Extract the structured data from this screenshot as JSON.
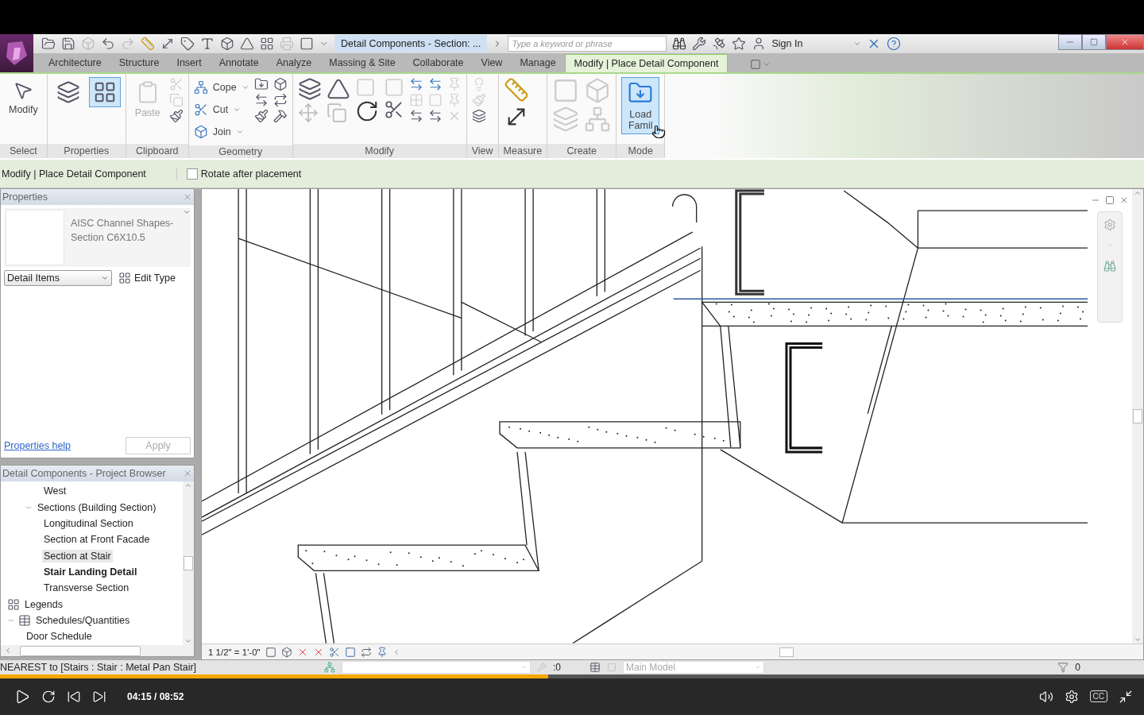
{
  "quick_access": {
    "title": "Detail Components - Section: ...",
    "search": {
      "placeholder": "Type a keyword or phrase"
    },
    "sign_in": "Sign In"
  },
  "ribbon_tabs": [
    {
      "label": "Architecture",
      "selected": false
    },
    {
      "label": "Structure",
      "selected": false
    },
    {
      "label": "Insert",
      "selected": false
    },
    {
      "label": "Annotate",
      "selected": false
    },
    {
      "label": "Analyze",
      "selected": false
    },
    {
      "label": "Massing & Site",
      "selected": false
    },
    {
      "label": "Collaborate",
      "selected": false
    },
    {
      "label": "View",
      "selected": false
    },
    {
      "label": "Manage",
      "selected": false
    },
    {
      "label": "Modify | Place Detail Component",
      "selected": true
    }
  ],
  "ribbon_panels": [
    {
      "kind": "select",
      "label": "Select",
      "buttons": [
        {
          "label": "Modify"
        }
      ]
    },
    {
      "kind": "properties",
      "label": "Properties",
      "buttons": [
        {
          "selected": false
        },
        {
          "selected": true
        }
      ]
    },
    {
      "kind": "clipboard",
      "label": "Clipboard",
      "buttons": [
        {
          "label": "Paste",
          "disabled": true
        }
      ]
    },
    {
      "kind": "geometry",
      "label": "Geometry",
      "buttons": [
        {
          "label": "Cope"
        },
        {
          "label": "Cut"
        },
        {
          "label": "Join"
        }
      ]
    },
    {
      "kind": "modify",
      "label": "Modify"
    },
    {
      "kind": "view",
      "label": "View"
    },
    {
      "kind": "measure",
      "label": "Measure"
    },
    {
      "kind": "create",
      "label": "Create"
    },
    {
      "kind": "mode",
      "label": "Mode",
      "buttons": [
        {
          "label": "Load Famil",
          "selected": true
        }
      ]
    }
  ],
  "options_bar": {
    "context": "Modify | Place Detail Component",
    "rotate": {
      "label": "Rotate after placement",
      "checked": false
    }
  },
  "properties": {
    "title": "Properties",
    "type_name": "AISC Channel Shapes-Section C6X10.5",
    "category": "Detail Items",
    "edit_type": "Edit Type",
    "help_link": "Properties help",
    "apply": {
      "label": "Apply",
      "disabled": true
    }
  },
  "project_browser": {
    "title": "Detail Components - Project Browser",
    "tree": [
      {
        "children": [
          {
            "children": [
              {
                "label": "West",
                "selected": false,
                "current": false
              }
            ]
          },
          {
            "label": "Sections (Building Section)",
            "expanded": true,
            "selected": false,
            "current": false,
            "children": [
              {
                "label": "Longitudinal Section",
                "selected": false,
                "current": false
              },
              {
                "label": "Section at Front Facade",
                "selected": false,
                "current": false
              },
              {
                "label": "Section at Stair",
                "selected": true,
                "current": false
              },
              {
                "label": "Stair Landing Detail",
                "selected": false,
                "current": true
              },
              {
                "label": "Transverse Section",
                "selected": false,
                "current": false
              }
            ]
          }
        ]
      },
      {
        "kind": "legend",
        "label": "Legends",
        "selected": false,
        "current": false
      },
      {
        "kind": "schedule",
        "label": "Schedules/Quantities",
        "expanded": true,
        "selected": false,
        "current": false,
        "children": [
          {
            "label": "Door Schedule",
            "selected": false,
            "current": false
          }
        ]
      }
    ]
  },
  "view": {
    "scale": "1 1/2\" = 1'-0\""
  },
  "status_bar": {
    "message": "NEAREST  to [Stairs : Stair : Metal Pan Stair]",
    "editable_count": ":0",
    "model": "Main Model",
    "filter_count": "0"
  },
  "player": {
    "time": "04:15 / 08:52",
    "progress": {
      "level": 0.479
    },
    "captions": "CC"
  }
}
